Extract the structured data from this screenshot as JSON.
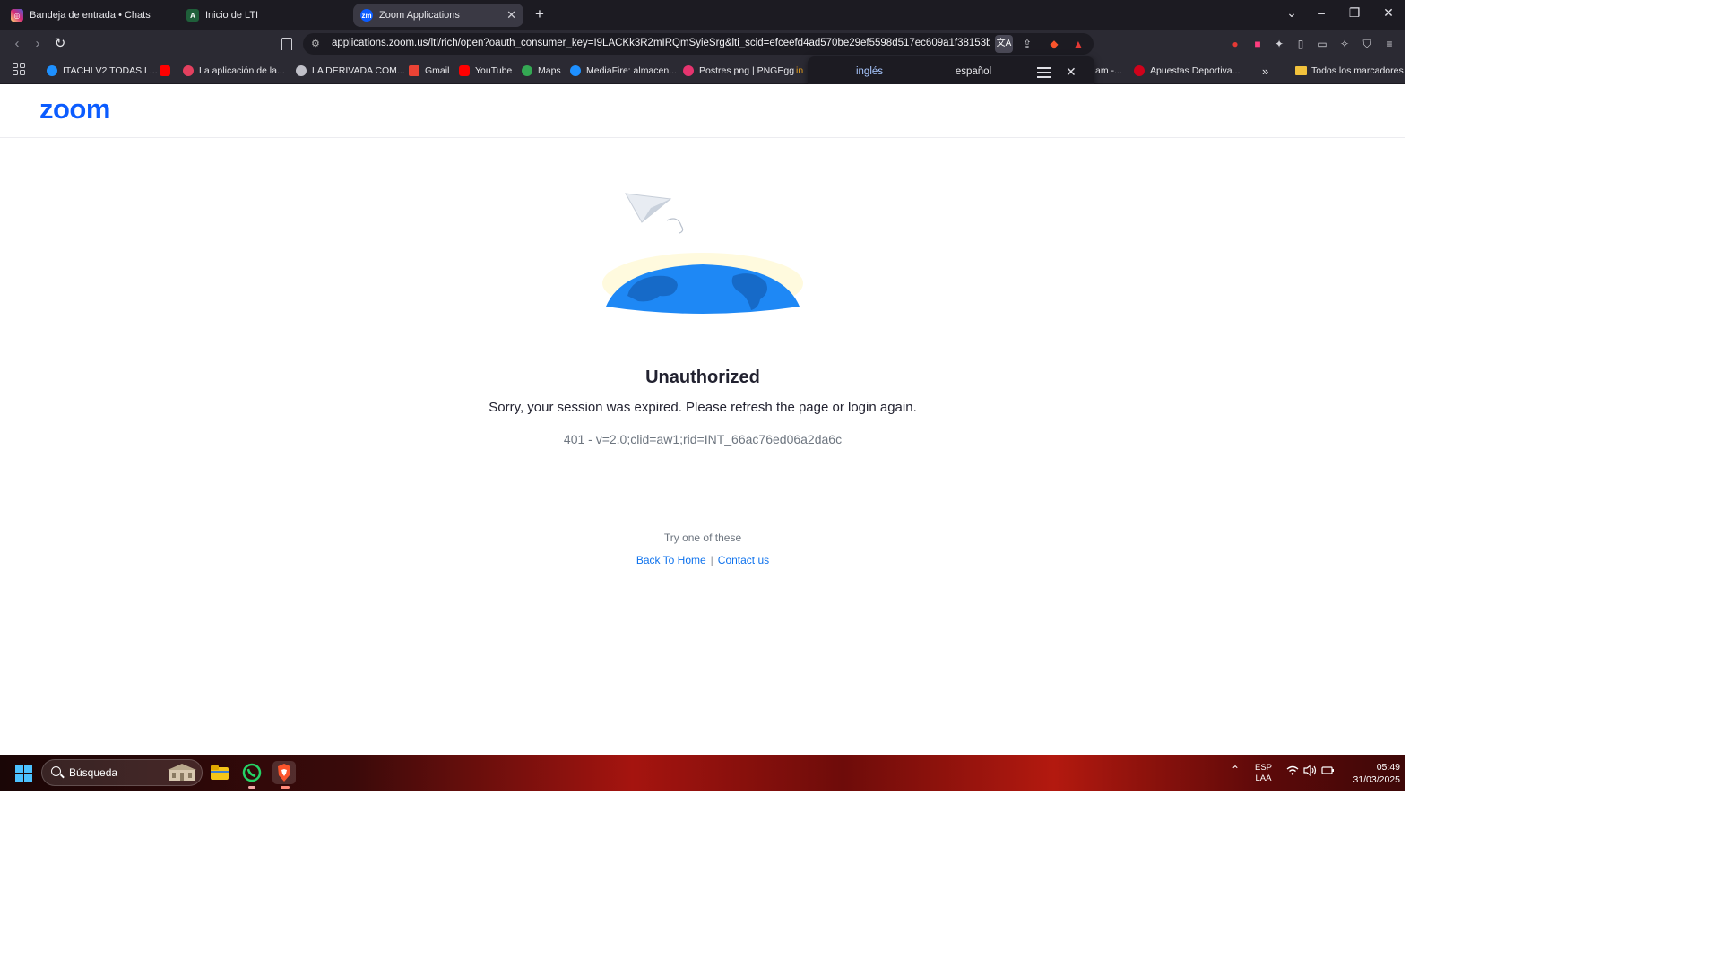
{
  "browser": {
    "tabs": [
      {
        "title": "Bandeja de entrada • Chats",
        "favicon": "instagram-icon",
        "color": "#d6249f"
      },
      {
        "title": "Inicio de LTI",
        "favicon": "lti-icon",
        "color": "#2a6b3c"
      },
      {
        "title": "Zoom Applications",
        "favicon": "zoom-icon",
        "color": "#0b5cff",
        "active": true
      }
    ],
    "url": "applications.zoom.us/lti/rich/open?oauth_consumer_key=I9LACKk3R2mIRQmSyieSrg&lti_scid=efceefd4ad570be29ef5598d517ec609a1f38153b...",
    "bookmarks": [
      {
        "label": "ITACHI V2 TODAS L...",
        "icon": "mediafire-icon",
        "color": "#1e90ff"
      },
      {
        "label": "",
        "icon": "youtube-icon",
        "color": "#ff0000"
      },
      {
        "label": "La aplicación de la...",
        "icon": "instagram-icon",
        "color": "#e4405f"
      },
      {
        "label": "LA DERIVADA COM...",
        "icon": "globe-icon",
        "color": "#c0c0c8"
      },
      {
        "label": "Gmail",
        "icon": "gmail-icon",
        "color": "#ea4335"
      },
      {
        "label": "YouTube",
        "icon": "youtube-icon",
        "color": "#ff0000"
      },
      {
        "label": "Maps",
        "icon": "maps-icon",
        "color": "#34a853"
      },
      {
        "label": "MediaFire: almacen...",
        "icon": "mediafire-icon",
        "color": "#1e90ff"
      },
      {
        "label": "Postres png | PNGEgg",
        "icon": "pngegg-icon",
        "color": "#e6346f"
      },
      {
        "label": "am -...",
        "icon": "",
        "color": "#ffffff"
      },
      {
        "label": "Apuestas Deportiva...",
        "icon": "apuestas-icon",
        "color": "#d0021b"
      },
      {
        "label": "»",
        "icon": "chevron-icon",
        "color": "#ffffff"
      },
      {
        "label": "Todos los marcadores",
        "icon": "folder-icon",
        "color": "#f2c23c"
      }
    ],
    "translate": {
      "source": "inglés",
      "target": "español"
    }
  },
  "page": {
    "logo": "zoom",
    "title": "Unauthorized",
    "message": "Sorry, your session was expired. Please refresh the page or login again.",
    "code": "401 - v=2.0;clid=aw1;rid=INT_66ac76ed06a2da6c",
    "try_label": "Try one of these",
    "link_home": "Back To Home",
    "link_separator": "|",
    "link_contact": "Contact us"
  },
  "taskbar": {
    "search_placeholder": "Búsqueda",
    "lang_top": "ESP",
    "lang_bottom": "LAA",
    "time": "05:49",
    "date": "31/03/2025"
  },
  "colors": {
    "zoom_blue": "#0b5cff",
    "link_blue": "#0e72ed",
    "chrome_dark": "#1c1b22",
    "toolbar": "#2b2a33"
  }
}
